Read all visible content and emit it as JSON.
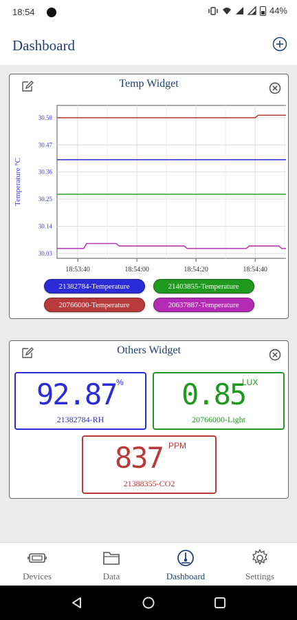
{
  "status_bar": {
    "time": "18:54",
    "battery": "44%"
  },
  "header": {
    "title": "Dashboard"
  },
  "temp_widget": {
    "title": "Temp Widget",
    "legend": [
      {
        "label": "21382784-Temperature",
        "color": "#2b2bd8"
      },
      {
        "label": "21403855-Temperature",
        "color": "#1f9a1f"
      },
      {
        "label": "20766000-Temperature",
        "color": "#b83a3a"
      },
      {
        "label": "20637887-Temperature",
        "color": "#b52ab5"
      }
    ]
  },
  "chart_data": {
    "type": "line",
    "title": "",
    "xlabel": "",
    "ylabel": "Temperature °C",
    "y_ticks": [
      "30.58",
      "30.47",
      "30.36",
      "30.25",
      "30.14",
      "30.03"
    ],
    "x_ticks": [
      "18:53:40",
      "18:54:00",
      "18:54:20",
      "18:54:40"
    ],
    "ylim": [
      30.01,
      30.63
    ],
    "xlim": [
      "18:53:33",
      "18:54:53"
    ],
    "grid": true,
    "series": [
      {
        "name": "21382784-Temperature",
        "color": "#3b3bd9",
        "points": [
          [
            "18:53:33",
            30.41
          ],
          [
            "18:54:53",
            30.41
          ]
        ]
      },
      {
        "name": "21403855-Temperature",
        "color": "#3aa63a",
        "points": [
          [
            "18:53:33",
            30.27
          ],
          [
            "18:54:53",
            30.27
          ]
        ]
      },
      {
        "name": "20766000-Temperature",
        "color": "#b84646",
        "points": [
          [
            "18:53:33",
            30.58
          ],
          [
            "18:54:40",
            30.58
          ],
          [
            "18:54:41",
            30.59
          ],
          [
            "18:54:53",
            30.59
          ]
        ]
      },
      {
        "name": "20637887-Temperature",
        "color": "#b43cb4",
        "points": [
          [
            "18:53:33",
            30.05
          ],
          [
            "18:53:42",
            30.05
          ],
          [
            "18:53:43",
            30.07
          ],
          [
            "18:53:53",
            30.07
          ],
          [
            "18:53:54",
            30.06
          ],
          [
            "18:54:16",
            30.06
          ],
          [
            "18:54:17",
            30.05
          ],
          [
            "18:54:37",
            30.05
          ],
          [
            "18:54:38",
            30.06
          ],
          [
            "18:54:48",
            30.06
          ],
          [
            "18:54:49",
            30.05
          ],
          [
            "18:54:53",
            30.05
          ]
        ]
      }
    ]
  },
  "others_widget": {
    "title": "Others Widget",
    "tiles": [
      {
        "value": "92.87",
        "unit": "%",
        "label": "21382784-RH",
        "color": "#2b2bd8"
      },
      {
        "value": "0.85",
        "unit": "LUX",
        "label": "20766000-Light",
        "color": "#1f9a1f"
      },
      {
        "value": "837",
        "unit": "PPM",
        "label": "21388355-CO2",
        "color": "#b83a3a"
      }
    ]
  },
  "bottom_nav": [
    {
      "label": "Devices",
      "icon": "devices-icon"
    },
    {
      "label": "Data",
      "icon": "folder-icon"
    },
    {
      "label": "Dashboard",
      "icon": "dashboard-icon",
      "active": true
    },
    {
      "label": "Settings",
      "icon": "gear-icon"
    }
  ]
}
